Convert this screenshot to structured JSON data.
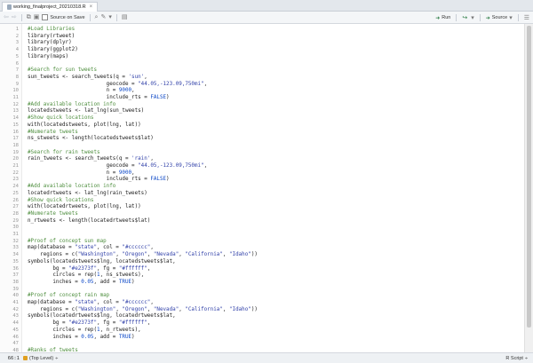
{
  "tab": {
    "filename": "working_finalproject_20210318.R",
    "close": "×"
  },
  "toolbar": {
    "source_on_save_label": "Source on Save",
    "run_label": "Run",
    "source_label": "Source",
    "rerun_glyph": "↪",
    "dropdown_glyph": "▾"
  },
  "colors": {
    "comment": "#4f8f3f",
    "string": "#2f3fa8",
    "number": "#0b47c7",
    "text": "#222222",
    "operator": "#555555"
  },
  "code_lines": [
    [
      [
        "c",
        "#Load Libraries"
      ]
    ],
    [
      [
        "t",
        "library(rtweet)"
      ]
    ],
    [
      [
        "t",
        "library(dplyr)"
      ]
    ],
    [
      [
        "t",
        "library(ggplot2)"
      ]
    ],
    [
      [
        "t",
        "library(maps)"
      ]
    ],
    [],
    [
      [
        "c",
        "#Search for sun tweets"
      ]
    ],
    [
      [
        "t",
        "sun_tweets <- search_tweets(q = "
      ],
      [
        "s",
        "'sun'"
      ],
      [
        "t",
        ","
      ]
    ],
    [
      [
        "t",
        "                         geocode = "
      ],
      [
        "s",
        "\"44.05,-123.09,750mi\""
      ],
      [
        "t",
        ","
      ]
    ],
    [
      [
        "t",
        "                         n = "
      ],
      [
        "n",
        "9000"
      ],
      [
        "t",
        ","
      ]
    ],
    [
      [
        "t",
        "                         include_rts = "
      ],
      [
        "n",
        "FALSE"
      ],
      [
        "t",
        ")"
      ]
    ],
    [
      [
        "c",
        "#Add available location info"
      ]
    ],
    [
      [
        "t",
        "locatedstweets <- lat_lng(sun_tweets)"
      ]
    ],
    [
      [
        "c",
        "#Show quick locations"
      ]
    ],
    [
      [
        "t",
        "with(locatedstweets, plot(lng, lat))"
      ]
    ],
    [
      [
        "c",
        "#Numerate tweets"
      ]
    ],
    [
      [
        "t",
        "ns_stweets <- length(locatedstweets$lat)"
      ]
    ],
    [],
    [
      [
        "c",
        "#Search for rain tweets"
      ]
    ],
    [
      [
        "t",
        "rain_tweets <- search_tweets(q = "
      ],
      [
        "s",
        "'rain'"
      ],
      [
        "t",
        ","
      ]
    ],
    [
      [
        "t",
        "                         geocode = "
      ],
      [
        "s",
        "\"44.05,-123.09,750mi\""
      ],
      [
        "t",
        ","
      ]
    ],
    [
      [
        "t",
        "                         n = "
      ],
      [
        "n",
        "9000"
      ],
      [
        "t",
        ","
      ]
    ],
    [
      [
        "t",
        "                         include_rts = "
      ],
      [
        "n",
        "FALSE"
      ],
      [
        "t",
        ")"
      ]
    ],
    [
      [
        "c",
        "#Add available location info"
      ]
    ],
    [
      [
        "t",
        "locatedrtweets <- lat_lng(rain_tweets)"
      ]
    ],
    [
      [
        "c",
        "#Show quick locations"
      ]
    ],
    [
      [
        "t",
        "with(locatedrtweets, plot(lng, lat))"
      ]
    ],
    [
      [
        "c",
        "#Numerate tweets"
      ]
    ],
    [
      [
        "t",
        "n_rtweets <- length(locatedrtweets$lat)"
      ]
    ],
    [],
    [],
    [
      [
        "c",
        "#Proof of concept sun map"
      ]
    ],
    [
      [
        "t",
        "map(database = "
      ],
      [
        "s",
        "\"state\""
      ],
      [
        "t",
        ", col = "
      ],
      [
        "s",
        "\"#cccccc\""
      ],
      [
        "t",
        ","
      ]
    ],
    [
      [
        "t",
        "    regions = c("
      ],
      [
        "s",
        "\"Washington\""
      ],
      [
        "t",
        ", "
      ],
      [
        "s",
        "\"Oregon\""
      ],
      [
        "t",
        ", "
      ],
      [
        "s",
        "\"Nevada\""
      ],
      [
        "t",
        ", "
      ],
      [
        "s",
        "\"California\""
      ],
      [
        "t",
        ", "
      ],
      [
        "s",
        "\"Idaho\""
      ],
      [
        "t",
        "))"
      ]
    ],
    [
      [
        "t",
        "symbols(locatedstweets$lng, locatedstweets$lat,"
      ]
    ],
    [
      [
        "t",
        "        bg = "
      ],
      [
        "s",
        "\"#e2373f\""
      ],
      [
        "t",
        ", fg = "
      ],
      [
        "s",
        "\"#ffffff\""
      ],
      [
        "t",
        ","
      ]
    ],
    [
      [
        "t",
        "        circles = rep("
      ],
      [
        "n",
        "1"
      ],
      [
        "t",
        ", ns_stweets),"
      ]
    ],
    [
      [
        "t",
        "        inches = "
      ],
      [
        "n",
        "0.05"
      ],
      [
        "t",
        ", add = "
      ],
      [
        "n",
        "TRUE"
      ],
      [
        "t",
        ")"
      ]
    ],
    [],
    [
      [
        "c",
        "#Proof of concept rain map"
      ]
    ],
    [
      [
        "t",
        "map(database = "
      ],
      [
        "s",
        "\"state\""
      ],
      [
        "t",
        ", col = "
      ],
      [
        "s",
        "\"#cccccc\""
      ],
      [
        "t",
        ","
      ]
    ],
    [
      [
        "t",
        "    regions = c("
      ],
      [
        "s",
        "\"Washington\""
      ],
      [
        "t",
        ", "
      ],
      [
        "s",
        "\"Oregon\""
      ],
      [
        "t",
        ", "
      ],
      [
        "s",
        "\"Nevada\""
      ],
      [
        "t",
        ", "
      ],
      [
        "s",
        "\"California\""
      ],
      [
        "t",
        ", "
      ],
      [
        "s",
        "\"Idaho\""
      ],
      [
        "t",
        "))"
      ]
    ],
    [
      [
        "t",
        "symbols(locatedrtweets$lng, locatedrtweets$lat,"
      ]
    ],
    [
      [
        "t",
        "        bg = "
      ],
      [
        "s",
        "\"#e2373f\""
      ],
      [
        "t",
        ", fg = "
      ],
      [
        "s",
        "\"#ffffff\""
      ],
      [
        "t",
        ","
      ]
    ],
    [
      [
        "t",
        "        circles = rep("
      ],
      [
        "n",
        "1"
      ],
      [
        "t",
        ", n_rtweets),"
      ]
    ],
    [
      [
        "t",
        "        inches = "
      ],
      [
        "n",
        "0.05"
      ],
      [
        "t",
        ", add = "
      ],
      [
        "n",
        "TRUE"
      ],
      [
        "t",
        ")"
      ]
    ],
    [],
    [
      [
        "c",
        "#Ranks of tweets"
      ]
    ]
  ],
  "status": {
    "cursor_position": "66:1",
    "scope": "(Top Level)",
    "scope_arrow": "÷",
    "file_type": "R Script",
    "file_type_arrow": "÷"
  }
}
